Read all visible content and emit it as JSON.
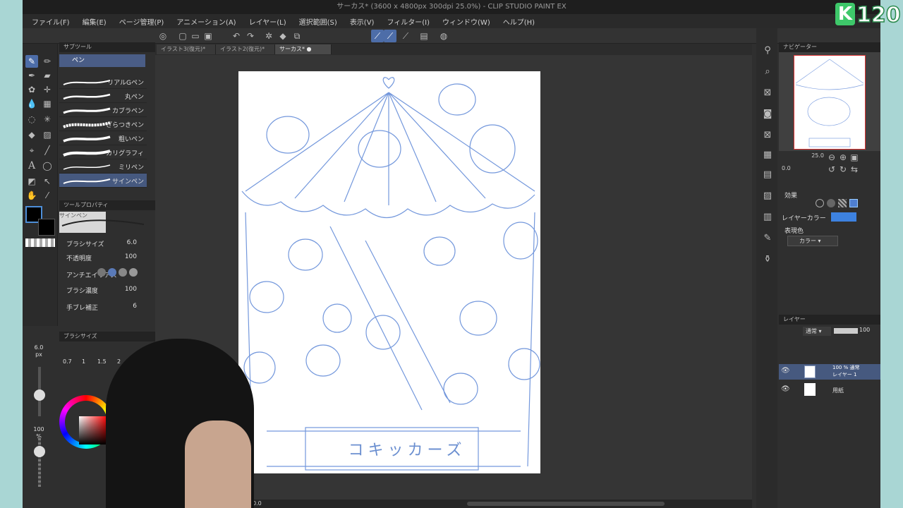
{
  "window": {
    "title": "サーカス* (3600 x 4800px 300dpi 25.0%)  - CLIP STUDIO PAINT EX"
  },
  "menu": [
    "ファイル(F)",
    "編集(E)",
    "ページ管理(P)",
    "アニメーション(A)",
    "レイヤー(L)",
    "選択範囲(S)",
    "表示(V)",
    "フィルター(I)",
    "ウィンドウ(W)",
    "ヘルプ(H)"
  ],
  "overlay": {
    "badge_letter": "K",
    "badge_number": "120"
  },
  "subtool": {
    "header": "サブツール",
    "selected_group": "ペン",
    "brushes": [
      "リアルGペン",
      "丸ペン",
      "カブラペン",
      "ざらつきペン",
      "粗いペン",
      "カリグラフィ",
      "ミリペン",
      "サインペン"
    ]
  },
  "toolprop": {
    "header": "ツールプロパティ",
    "name": "サインペン",
    "rows": [
      {
        "label": "ブラシサイズ",
        "value": "6.0"
      },
      {
        "label": "不透明度",
        "value": "100"
      },
      {
        "label": "アンチエイリアス",
        "value": ""
      },
      {
        "label": "ブラシ濃度",
        "value": "100"
      },
      {
        "label": "手ブレ補正",
        "value": "6"
      }
    ]
  },
  "brushsize": {
    "header": "ブラシサイズ",
    "current": "6.0",
    "unit": "px",
    "presets": [
      "0.7",
      "1",
      "1.5",
      "2"
    ],
    "opacity": "100",
    "opacity_unit": "%"
  },
  "docs": {
    "tabs": [
      "イラスト3(復元)*",
      "イラスト2(復元)*",
      "サーカス*"
    ],
    "active": 2
  },
  "canvas": {
    "banner_text": "コキッカーズ"
  },
  "statusbar": {
    "zoom": "0.0"
  },
  "navigator": {
    "header": "ナビゲーター",
    "zoom": "25.0",
    "angle": "0.0"
  },
  "layerprop": {
    "effect_label": "効果",
    "layer_color_label": "レイヤーカラー",
    "layer_color": "#3d82e0",
    "expression_label": "表現色",
    "expression_value": "カラー"
  },
  "layers": {
    "header": "レイヤー",
    "blend": "通常",
    "opacity": "100",
    "items": [
      {
        "pct": "100 % 通常",
        "name": "レイヤー 1",
        "selected": true
      },
      {
        "pct": "",
        "name": "用紙",
        "selected": false
      }
    ]
  }
}
